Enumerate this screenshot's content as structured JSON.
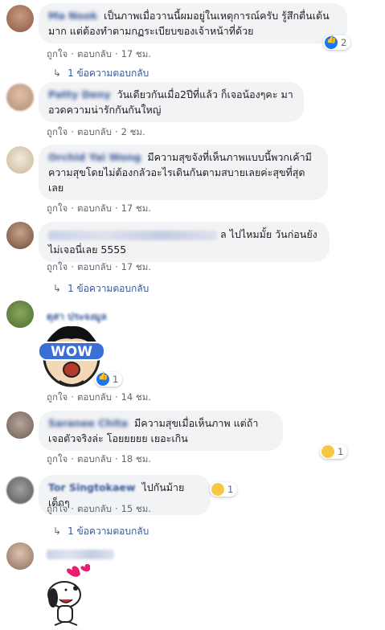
{
  "comments": [
    {
      "name": "Ma Nook",
      "text": "เป็นภาพเมื่อวานนี้ผมอยู่ในเหตุการณ์ครับ รู้สึกตื่นเต้นมาก แต่ต้องทำตามกฏระเบียบของเจ้าหน้าที่ด้วย",
      "like": "ถูกใจ",
      "reply": "ตอบกลับ",
      "time": "17 ชม.",
      "reactions": "2",
      "replies": "1 ข้อความตอบกลับ"
    },
    {
      "name": "Patty Deny",
      "text": "วันเดียวกันเมื่อ2ปีที่แล้ว ก็เจอน้องๆคะ มาอวดความน่ารักกันกันใหญ่",
      "like": "ถูกใจ",
      "reply": "ตอบกลับ",
      "time": "2 ชม."
    },
    {
      "name": "Orchid Yai Wong",
      "text": "มีความสุขจังที่เห็นภาพแบบนี้พวกเค้ามีความสุขโดยไม่ต้องกลัวอะไรเดินกันตามสบายเลยค่ะสุขที่สุดเลย",
      "like": "ถูกใจ",
      "reply": "ตอบกลับ",
      "time": "17 ชม."
    },
    {
      "name": "",
      "text_suffix": "ล",
      "text": "ไปไหมมั้ย วันก่อนยังไม่เจอนี่เลย 5555",
      "like": "ถูกใจ",
      "reply": "ตอบกลับ",
      "time": "17 ชม.",
      "replies": "1 ข้อความตอบกลับ"
    },
    {
      "name": "ดุสา ประจงมูล",
      "sticker_text": "WOW",
      "like": "ถูกใจ",
      "reply": "ตอบกลับ",
      "time": "14 ชม.",
      "reactions": "1"
    },
    {
      "name": "Saranee Chita",
      "text": "มีความสุขเมื่อเห็นภาพ แต่ถ้าเจอตัวจริงล่ะ โอยยยยย เยอะเกิน",
      "like": "ถูกใจ",
      "reply": "ตอบกลับ",
      "time": "18 ชม.",
      "reactions": "1"
    },
    {
      "name": "Tor Singtokaew",
      "text": "ไปกันม้ายเด็กๆ",
      "like": "ถูกใจ",
      "reply": "ตอบกลับ",
      "time": "15 ชม.",
      "reactions": "1",
      "replies": "1 ข้อความตอบกลับ"
    },
    {
      "name": ""
    }
  ],
  "colors": {
    "bubble": "#f2f3f5",
    "link": "#385898",
    "meta": "#606770",
    "like": "#1877f2",
    "haha": "#f7c744"
  }
}
